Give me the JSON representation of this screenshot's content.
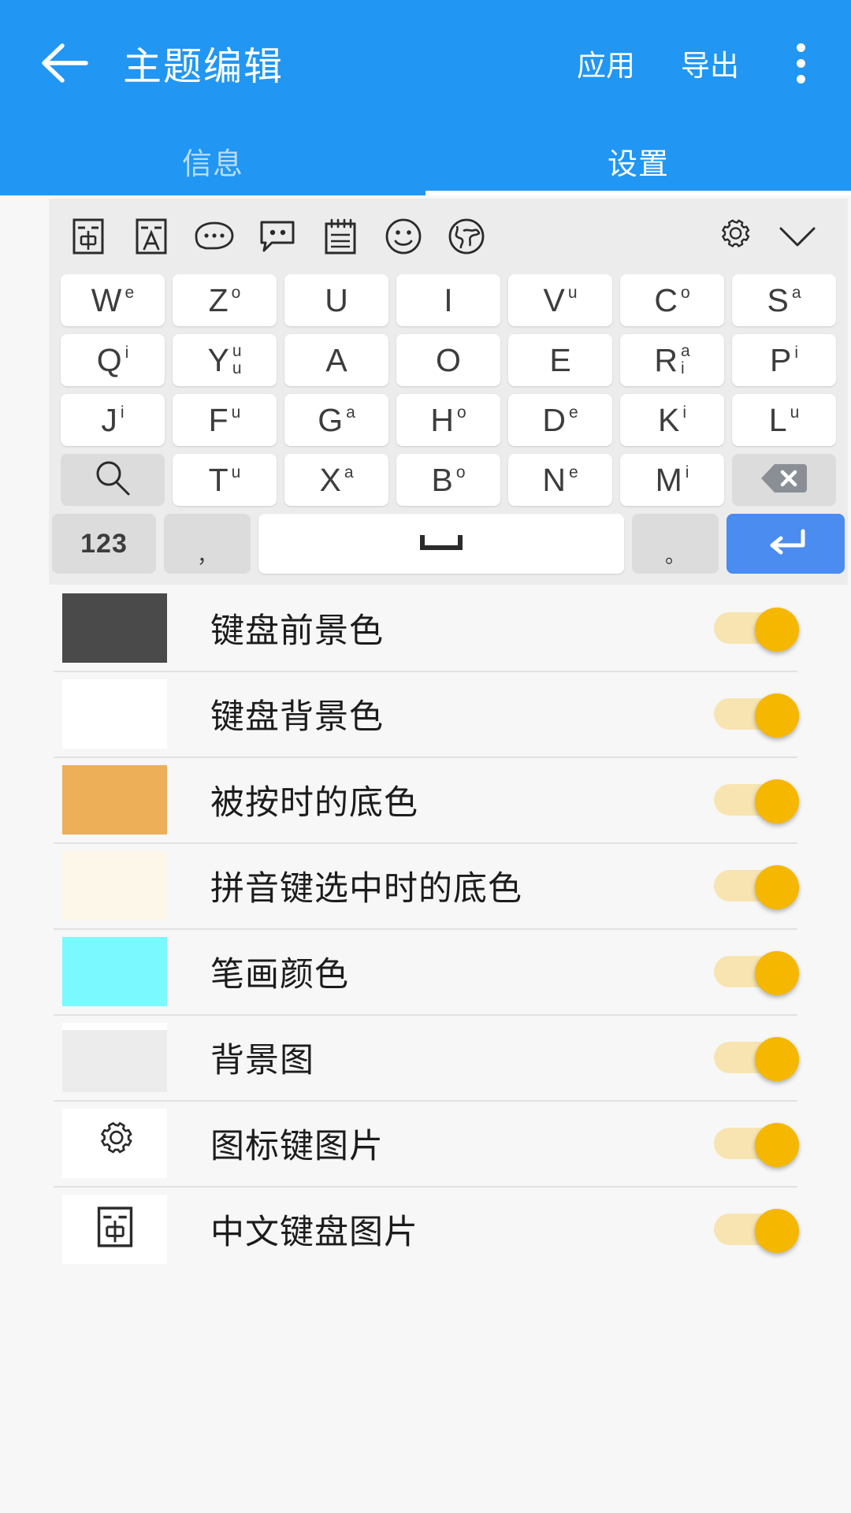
{
  "appbar": {
    "back_icon": "arrow-left-icon",
    "title": "主题编辑",
    "action_apply": "应用",
    "action_export": "导出",
    "overflow_icon": "more-vertical-icon",
    "background_color": "#2196f3"
  },
  "tabs": [
    {
      "label": "信息",
      "active": false
    },
    {
      "label": "设置",
      "active": true
    }
  ],
  "keyboard": {
    "toolbar": [
      {
        "icon": "chinese-input-box-icon"
      },
      {
        "icon": "latin-input-box-icon"
      },
      {
        "icon": "speech-bubble-dots-icon"
      },
      {
        "icon": "chat-bubble-eyes-icon"
      },
      {
        "icon": "clipboard-notes-icon"
      },
      {
        "icon": "smiley-face-icon"
      },
      {
        "icon": "globe-icon"
      }
    ],
    "toolbar_right": [
      {
        "icon": "gear-icon"
      },
      {
        "icon": "chevron-down-icon"
      }
    ],
    "rows": [
      [
        {
          "main": "W",
          "sups": [
            "e"
          ]
        },
        {
          "main": "Z",
          "sups": [
            "o"
          ]
        },
        {
          "main": "U",
          "sups": []
        },
        {
          "main": "I",
          "sups": []
        },
        {
          "main": "V",
          "sups": [
            "u"
          ]
        },
        {
          "main": "C",
          "sups": [
            "o"
          ]
        },
        {
          "main": "S",
          "sups": [
            "a"
          ]
        }
      ],
      [
        {
          "main": "Q",
          "sups": [
            "i"
          ]
        },
        {
          "main": "Y",
          "sups": [
            "u",
            "u"
          ]
        },
        {
          "main": "A",
          "sups": []
        },
        {
          "main": "O",
          "sups": []
        },
        {
          "main": "E",
          "sups": []
        },
        {
          "main": "R",
          "sups": [
            "a",
            "i"
          ]
        },
        {
          "main": "P",
          "sups": [
            "i"
          ]
        }
      ],
      [
        {
          "main": "J",
          "sups": [
            "i"
          ]
        },
        {
          "main": "F",
          "sups": [
            "u"
          ]
        },
        {
          "main": "G",
          "sups": [
            "a"
          ]
        },
        {
          "main": "H",
          "sups": [
            "o"
          ]
        },
        {
          "main": "D",
          "sups": [
            "e"
          ]
        },
        {
          "main": "K",
          "sups": [
            "i"
          ]
        },
        {
          "main": "L",
          "sups": [
            "u"
          ]
        }
      ],
      [
        {
          "icon": "search-icon",
          "func": true
        },
        {
          "main": "T",
          "sups": [
            "u"
          ]
        },
        {
          "main": "X",
          "sups": [
            "a"
          ]
        },
        {
          "main": "B",
          "sups": [
            "o"
          ]
        },
        {
          "main": "N",
          "sups": [
            "e"
          ]
        },
        {
          "main": "M",
          "sups": [
            "i"
          ]
        },
        {
          "icon": "backspace-icon",
          "func": true
        }
      ]
    ],
    "bottom_row": {
      "num_label": "123",
      "comma_label": "，",
      "space_icon": "space-bar-icon",
      "period_label": "。",
      "enter_icon": "enter-icon",
      "enter_color": "#4a8cf0"
    }
  },
  "settings": [
    {
      "label": "键盘前景色",
      "swatch_color": "#4a4a4a",
      "swatch_kind": "color",
      "toggle_on": true
    },
    {
      "label": "键盘背景色",
      "swatch_color": "#ffffff",
      "swatch_kind": "color",
      "toggle_on": true
    },
    {
      "label": "被按时的底色",
      "swatch_color": "#edaf58",
      "swatch_kind": "color",
      "toggle_on": true
    },
    {
      "label": "拼音键选中时的底色",
      "swatch_color": "#fdf7ea",
      "swatch_kind": "color",
      "toggle_on": true
    },
    {
      "label": "笔画颜色",
      "swatch_color": "#7afaff",
      "swatch_kind": "color",
      "toggle_on": true
    },
    {
      "label": "背景图",
      "swatch_color": "#ececec",
      "swatch_kind": "image",
      "toggle_on": true
    },
    {
      "label": "图标键图片",
      "swatch_color": "#ffffff",
      "swatch_kind": "gear",
      "toggle_on": true
    },
    {
      "label": "中文键盘图片",
      "swatch_color": "#ffffff",
      "swatch_kind": "chinese",
      "toggle_on": true
    }
  ],
  "colors": {
    "primary": "#2196f3",
    "toggle_on": "#f5b700",
    "toggle_track": "#f7e4b0",
    "page_bg": "#f7f7f7",
    "keyboard_bg": "#ececec"
  }
}
